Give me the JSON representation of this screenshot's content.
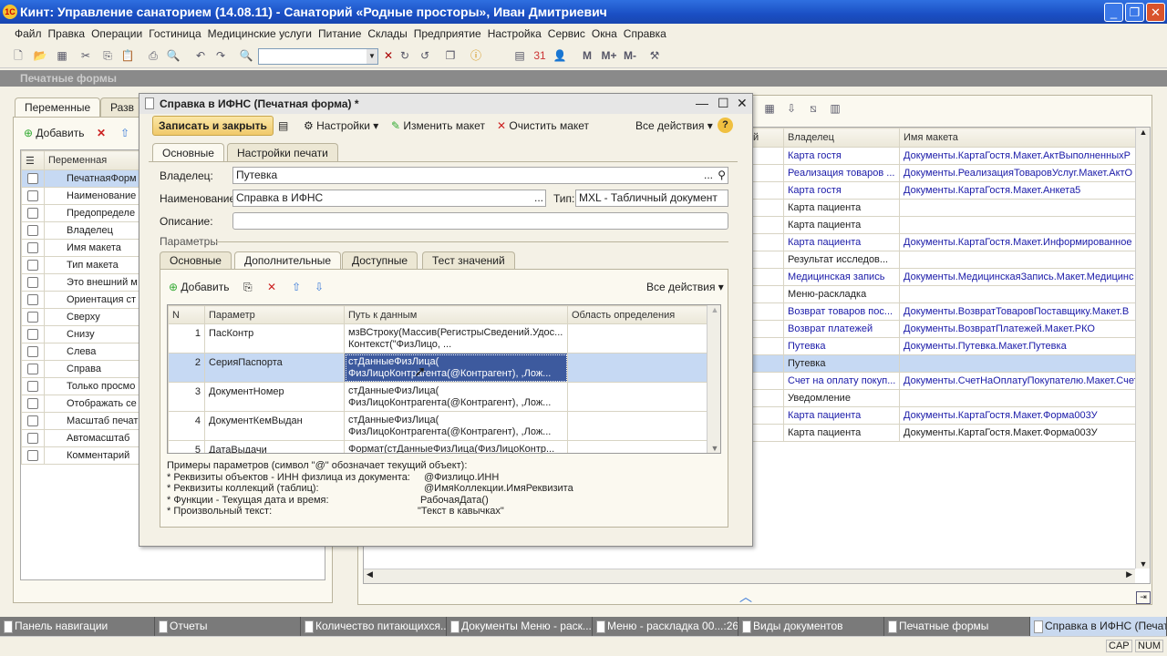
{
  "app": {
    "title": "Кинт: Управление санаторием (14.08.11) - Санаторий «Родные просторы», Иван Дмитриевич",
    "logo": "1С"
  },
  "menu": [
    "Файл",
    "Правка",
    "Операции",
    "Гостиница",
    "Медицинские услуги",
    "Питание",
    "Склады",
    "Предприятие",
    "Настройка",
    "Сервис",
    "Окна",
    "Справка"
  ],
  "toolbar": {
    "search_value": "",
    "memory": [
      "M",
      "M+",
      "M-"
    ]
  },
  "bg_window": {
    "title": "Печатные формы",
    "tabs": [
      "Переменные",
      "Разв"
    ],
    "add_label": "Добавить",
    "var_header": "Переменная",
    "variables": [
      "ПечатнаяФорм",
      "Наименование",
      "Предопределе",
      "Владелец",
      "Имя макета",
      "Тип макета",
      "Это внешний м",
      "Ориентация ст",
      "Сверху",
      "Снизу",
      "Слева",
      "Справа",
      "Только просмо",
      "Отображать се",
      "Масштаб печат",
      "Автомасштаб",
      "Комментарий"
    ],
    "list_headers": [
      "й",
      "Владелец",
      "Имя макета"
    ],
    "list_rows": [
      {
        "owner": "Карта гостя",
        "template": "Документы.КартаГостя.Макет.АктВыполненныхР",
        "link": true
      },
      {
        "owner": "Реализация товаров ...",
        "template": "Документы.РеализацияТоваровУслуг.Макет.АктО",
        "link": true
      },
      {
        "owner": "Карта гостя",
        "template": "Документы.КартаГостя.Макет.Анкета5",
        "link": true
      },
      {
        "owner": "Карта пациента",
        "template": "",
        "link": false
      },
      {
        "owner": "Карта пациента",
        "template": "",
        "link": false
      },
      {
        "owner": "Карта пациента",
        "template": "Документы.КартаГостя.Макет.Информированное",
        "link": true
      },
      {
        "owner": "Результат исследов...",
        "template": "",
        "link": false
      },
      {
        "owner": "Медицинская запись",
        "template": "Документы.МедицинскаяЗапись.Макет.Медицинс",
        "link": true
      },
      {
        "owner": "Меню-раскладка",
        "template": "",
        "link": false
      },
      {
        "owner": "Возврат товаров пос...",
        "template": "Документы.ВозвратТоваровПоставщику.Макет.В",
        "link": true
      },
      {
        "owner": "Возврат платежей",
        "template": "Документы.ВозвратПлатежей.Макет.РКО",
        "link": true
      },
      {
        "owner": "Путевка",
        "template": "Документы.Путевка.Макет.Путевка",
        "link": true
      },
      {
        "owner": "Путевка",
        "template": "",
        "link": false,
        "selected": true
      },
      {
        "owner": "Счет на оплату покуп...",
        "template": "Документы.СчетНаОплатуПокупателю.Макет.Счет",
        "link": true
      },
      {
        "owner": "Уведомление",
        "template": "",
        "link": false
      },
      {
        "owner": "Карта пациента",
        "template": "Документы.КартаГостя.Макет.Форма003У",
        "link": true
      },
      {
        "owner": "Карта пациента",
        "template": "Документы.КартаГостя.Макет.Форма003У",
        "link": false
      }
    ]
  },
  "dialog": {
    "title": "Справка в ИФНС (Печатная форма) *",
    "save_close": "Записать и закрыть",
    "settings": "Настройки",
    "edit_template": "Изменить макет",
    "clear_template": "Очистить макет",
    "all_actions": "Все действия",
    "help": "?",
    "tabs": [
      "Основные",
      "Настройки печати"
    ],
    "owner_label": "Владелец:",
    "owner_value": "Путевка",
    "name_label": "Наименование:",
    "name_value": "Справка в ИФНС",
    "type_label": "Тип:",
    "type_value": "MXL - Табличный документ",
    "desc_label": "Описание:",
    "desc_value": "",
    "params_label": "Параметры",
    "inner_tabs": [
      "Основные",
      "Дополнительные",
      "Доступные",
      "Тест значений"
    ],
    "add_label": "Добавить",
    "inner_all_actions": "Все действия",
    "headers": [
      "N",
      "Параметр",
      "Путь к данным",
      "Область определения"
    ],
    "rows": [
      {
        "n": "1",
        "param": "ПасКонтр",
        "path1": "мзВСтроку(Массив(РегистрыСведений.Удос...",
        "path2": " Контекст(\"ФизЛицо, ...",
        "scope": ""
      },
      {
        "n": "2",
        "param": "СерияПаспорта",
        "path1": "стДанныеФизЛица(",
        "path2": "ФизЛицоКонтрагента(@Контрагент), ,Лож...",
        "scope": "",
        "selected": true
      },
      {
        "n": "3",
        "param": "ДокументНомер",
        "path1": "стДанныеФизЛица(",
        "path2": "ФизЛицоКонтрагента(@Контрагент), ,Лож...",
        "scope": ""
      },
      {
        "n": "4",
        "param": "ДокументКемВыдан",
        "path1": "стДанныеФизЛица(",
        "path2": "ФизЛицоКонтрагента(@Контрагент), ,Лож...",
        "scope": ""
      },
      {
        "n": "5",
        "param": "ДатаВыдачи",
        "path1": "Формат(стДанныеФизЛица(ФизЛицоКонтр...",
        "path2": "",
        "scope": ""
      }
    ],
    "help_title": "Примеры параметров (символ \"@\" обозначает текущий объект):",
    "help_lines": [
      {
        "k": "* Реквизиты объектов - ИНН физлица из документа:",
        "v": "@Физлицо.ИНН"
      },
      {
        "k": "* Реквизиты коллекций (таблиц):",
        "v": "@ИмяКоллекции.ИмяРеквизита"
      },
      {
        "k": "* Функции - Текущая дата и время:",
        "v": "РабочаяДата()"
      },
      {
        "k": "* Произвольный текст:",
        "v": "\"Текст в кавычках\""
      }
    ]
  },
  "taskbar": [
    "Панель навигации",
    "Отчеты",
    "Количество питающихся...",
    "Документы Меню - раск...",
    "Меню - раскладка 00...:26",
    "Виды документов",
    "Печатные формы",
    "Справка в ИФНС (Печат..."
  ],
  "status": {
    "cap": "CAP",
    "num": "NUM"
  },
  "colors": {
    "title_blue": "#1a4fc4",
    "link": "#1a1aa8",
    "selection": "#c6d9f3",
    "cell_selection": "#3d5a9e"
  }
}
